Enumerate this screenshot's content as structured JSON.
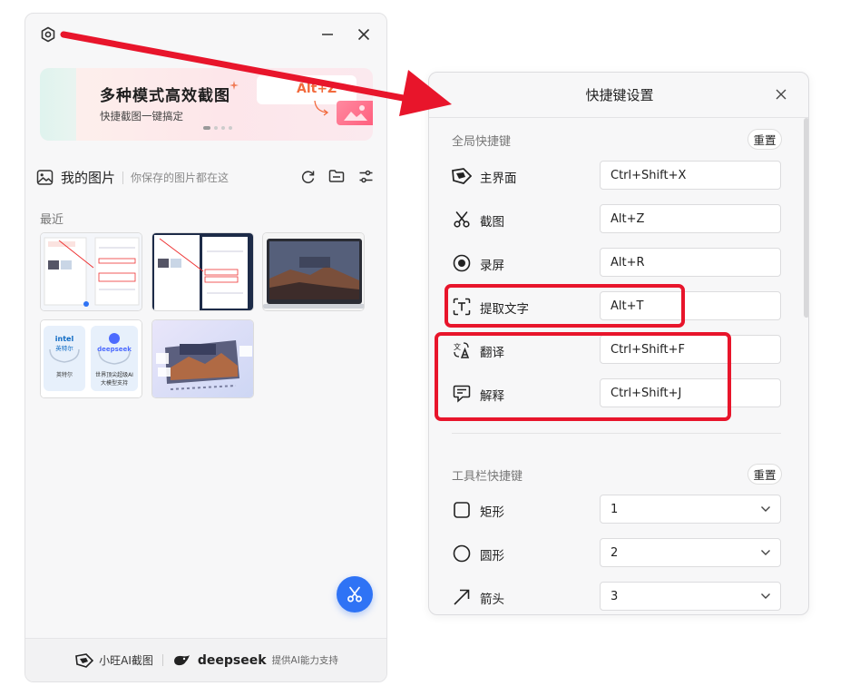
{
  "main_window": {
    "banner": {
      "title": "多种模式高效截图",
      "subtitle": "快捷截图一键搞定",
      "hotkey": "Alt+Z"
    },
    "my_images": {
      "title": "我的图片",
      "subtitle": "你保存的图片都在这"
    },
    "recent_label": "最近",
    "thumbnails": [
      {
        "type": "screenshot"
      },
      {
        "type": "screenshot"
      },
      {
        "type": "laptop-wallpaper"
      },
      {
        "type": "promo",
        "texts": [
          "intel",
          "英特尔",
          "deepseek",
          "世界顶尖超级AI",
          "大模型支持"
        ]
      },
      {
        "type": "gallery"
      }
    ],
    "footer": {
      "app_name": "小旺AI截图",
      "partner": "deepseek",
      "partner_sub": "提供AI能力支持"
    }
  },
  "dialog": {
    "title": "快捷键设置",
    "global_group": {
      "title": "全局快捷键",
      "reset_label": "重置",
      "rows": [
        {
          "icon": "main-window-icon",
          "label": "主界面",
          "value": "Ctrl+Shift+X"
        },
        {
          "icon": "scissors-icon",
          "label": "截图",
          "value": "Alt+Z"
        },
        {
          "icon": "record-icon",
          "label": "录屏",
          "value": "Alt+R"
        },
        {
          "icon": "text-extract-icon",
          "label": "提取文字",
          "value": "Alt+T"
        },
        {
          "icon": "translate-icon",
          "label": "翻译",
          "value": "Ctrl+Shift+F"
        },
        {
          "icon": "explain-icon",
          "label": "解释",
          "value": "Ctrl+Shift+J"
        }
      ]
    },
    "toolbar_group": {
      "title": "工具栏快捷键",
      "reset_label": "重置",
      "rows": [
        {
          "icon": "rectangle-icon",
          "label": "矩形",
          "value": "1"
        },
        {
          "icon": "circle-icon",
          "label": "圆形",
          "value": "2"
        },
        {
          "icon": "arrow-icon",
          "label": "箭头",
          "value": "3"
        }
      ]
    }
  },
  "colors": {
    "accent_blue": "#2f73f5",
    "highlight_red": "#e8152b",
    "banner_orange": "#f26a3d"
  }
}
